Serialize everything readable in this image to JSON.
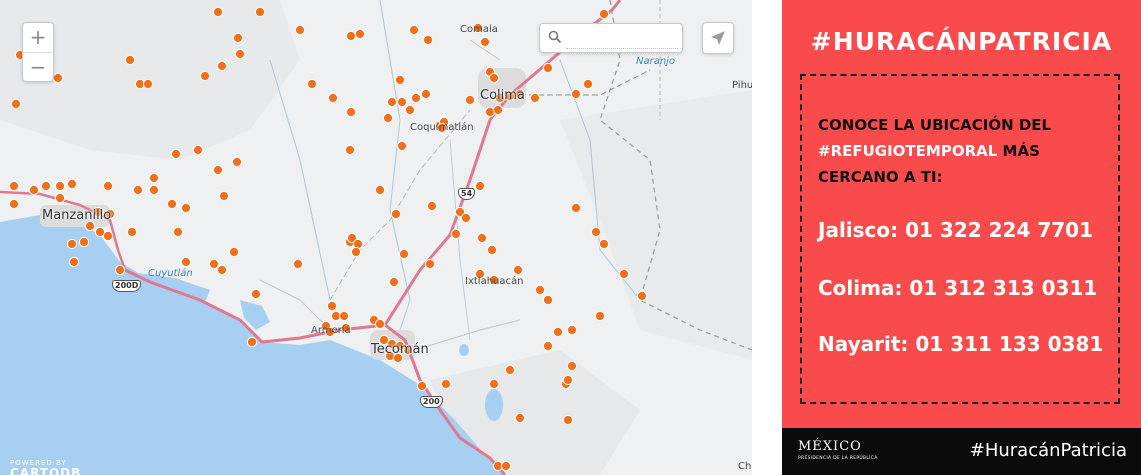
{
  "map": {
    "zoom_in_label": "+",
    "zoom_out_label": "−",
    "search": {
      "placeholder": "",
      "value": ""
    },
    "icons": {
      "search": "search-icon",
      "locate": "location-arrow-icon"
    },
    "attribution_top": "POWERED BY",
    "attribution_brand": "CARTODB",
    "marker_color": "#f26f1a",
    "labels": {
      "manzanillo": "Manzanillo",
      "colima": "Colima",
      "comala": "Comala",
      "coquimatlan": "Coquimatlán",
      "cuyutlan": "Cuyutlán",
      "ixtlahuacan": "Ixtlahuacán",
      "tecoman": "Tecomán",
      "armeria": "Armería",
      "naranjo": "Naranjo",
      "pihuamo": "Pihu",
      "chinicuila": "Chi"
    },
    "route_shields": {
      "r200d": "200D",
      "r200": "200",
      "r54": "54"
    }
  },
  "panel": {
    "title": "#HURACÁNPATRICIA",
    "lead_part1": "CONOCE LA UBICACIÓN DEL ",
    "lead_highlight": "#REFUGIOTEMPORAL",
    "lead_part2": " MÁS CERCANO A TI:",
    "phones": [
      "Jalisco: 01 322 224 7701",
      "Colima: 01 312 313 0311",
      "Nayarit: 01 311 133 0381"
    ],
    "background_color": "#f94b4b"
  },
  "footer": {
    "logo_name": "MÉXICO",
    "logo_sub": "PRESIDENCIA DE LA REPÚBLICA",
    "hashtag": "#HuracánPatricia"
  }
}
